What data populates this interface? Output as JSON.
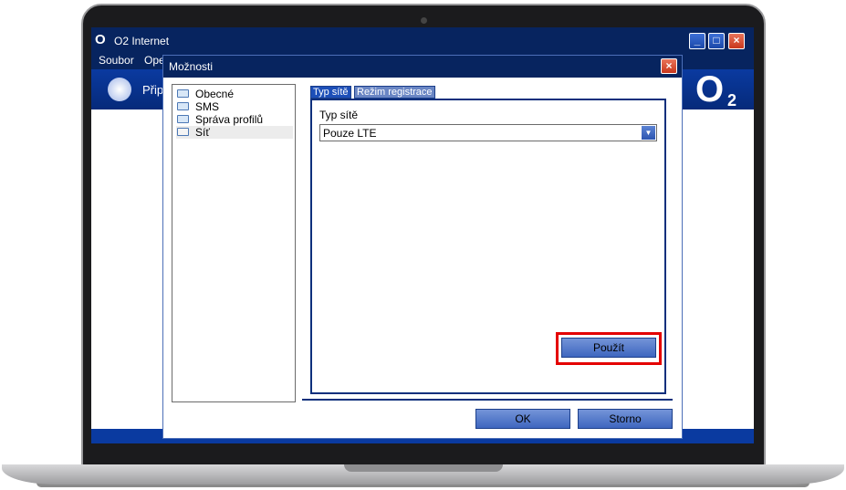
{
  "app": {
    "title": "O2 Internet",
    "logo": "O",
    "logo_sub": "2",
    "menu": [
      "Soubor",
      "Ope"
    ],
    "banner_text": "Přip",
    "window_controls": {
      "minimize": "_",
      "maximize": "□",
      "close": "×"
    }
  },
  "dialog": {
    "title": "Možnosti",
    "close": "×",
    "tree": [
      {
        "label": "Obecné",
        "icon": "folder-icon"
      },
      {
        "label": "SMS",
        "icon": "folder-icon"
      },
      {
        "label": "Správa profilů",
        "icon": "folder-icon"
      },
      {
        "label": "Síť",
        "icon": "folder-open-icon",
        "selected": true
      }
    ],
    "tabs": [
      {
        "label": "Typ sítě",
        "active": true
      },
      {
        "label": "Režim registrace",
        "active": false
      }
    ],
    "network_type": {
      "label": "Typ sítě",
      "value": "Pouze LTE",
      "arrow": "▼"
    },
    "apply_button": "Použít",
    "ok_button": "OK",
    "cancel_button": "Storno"
  },
  "colors": {
    "titlebar": "#07245f",
    "accent": "#1d4fb8",
    "highlight": "#e40000"
  }
}
